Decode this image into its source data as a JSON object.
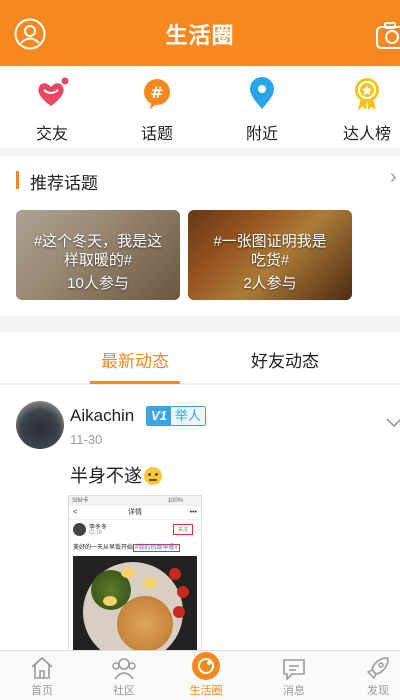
{
  "header": {
    "title": "生活圈"
  },
  "quicknav": {
    "items": [
      {
        "label": "交友"
      },
      {
        "label": "话题"
      },
      {
        "label": "附近"
      },
      {
        "label": "达人榜"
      }
    ]
  },
  "topics": {
    "title": "推荐话题",
    "more": "›",
    "cards": [
      {
        "text": "#这个冬天，我是这样取暖的#",
        "count": "10人参与"
      },
      {
        "text": "#一张图证明我是吃货#",
        "count": "2人参与"
      }
    ]
  },
  "tabs": {
    "items": [
      {
        "label": "最新动态"
      },
      {
        "label": "好友动态"
      }
    ]
  },
  "post": {
    "username": "Aikachin",
    "badge_v": "V1",
    "badge_text": "举人",
    "date": "11-30",
    "text": "半身不遂",
    "screenshot": {
      "status": "SIM卡",
      "battery": "100%",
      "nav_title": "详情",
      "back": "<",
      "more": "•••",
      "user": "李冬冬",
      "user_date": "02-18",
      "follow": "关注",
      "caption_prefix": "美好的一天从早饭开始",
      "caption_tag": "#我的別致早餐#"
    }
  },
  "bottomnav": {
    "items": [
      {
        "label": "首页"
      },
      {
        "label": "社区"
      },
      {
        "label": "生活圈"
      },
      {
        "label": "消息"
      },
      {
        "label": "发现"
      }
    ]
  },
  "colors": {
    "accent": "#f5891f",
    "badge": "#3ba4e5",
    "heart": "#e8475f",
    "location": "#2aa6e8",
    "medal": "#f2c518"
  }
}
